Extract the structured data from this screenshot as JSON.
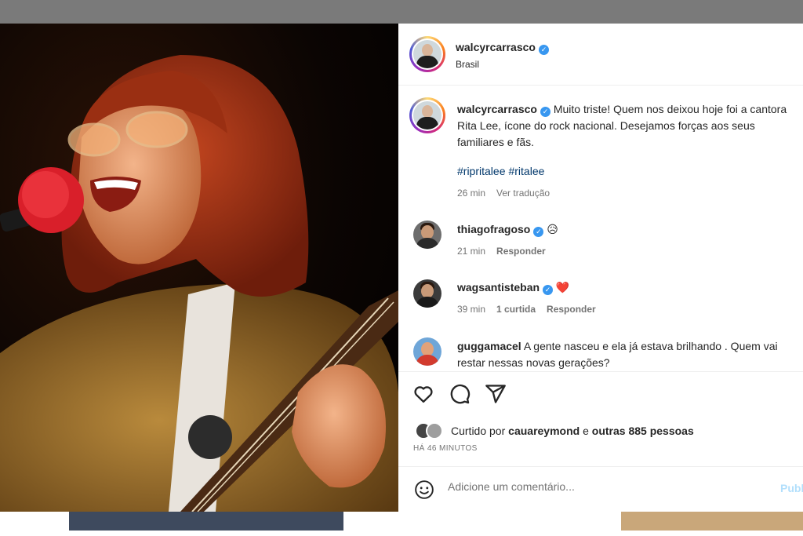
{
  "post": {
    "author": {
      "username": "walcyrcarrasco",
      "location": "Brasil",
      "verified": true
    },
    "caption": {
      "username": "walcyrcarrasco",
      "text": "Muito triste! Quem nos deixou hoje foi a cantora Rita Lee, ícone do rock nacional. Desejamos forças aos seus familiares e fãs.",
      "hashtags": [
        "#ripritalee",
        "#ritalee"
      ],
      "time": "26 min",
      "translate_label": "Ver tradução"
    },
    "comments": [
      {
        "username": "thiagofragoso",
        "verified": true,
        "text": "😥",
        "time": "21 min",
        "likes": "",
        "reply_label": "Responder"
      },
      {
        "username": "wagsantisteban",
        "verified": true,
        "text": "❤️",
        "time": "39 min",
        "likes": "1 curtida",
        "reply_label": "Responder"
      },
      {
        "username": "guggamacel",
        "verified": false,
        "text": "A gente nasceu e ela já estava brilhando . Quem vai restar nessas novas gerações?"
      }
    ],
    "likes": {
      "prefix": "Curtido por",
      "first_user": "cauareymond",
      "connector": "e",
      "others": "outras 885 pessoas"
    },
    "time_ago": "HÁ 46 MINUTOS",
    "comment_input": {
      "placeholder": "Adicione um comentário...",
      "publish_label": "Publ"
    }
  },
  "icons": {
    "like": "heart-icon",
    "comment": "comment-bubble-icon",
    "share": "paper-plane-icon",
    "emoji": "smiley-icon",
    "verified": "verified-badge-icon"
  },
  "colors": {
    "verified": "#3897f0",
    "hashtag": "#00376b",
    "muted": "#737373",
    "publish_disabled": "#b2dffc"
  }
}
